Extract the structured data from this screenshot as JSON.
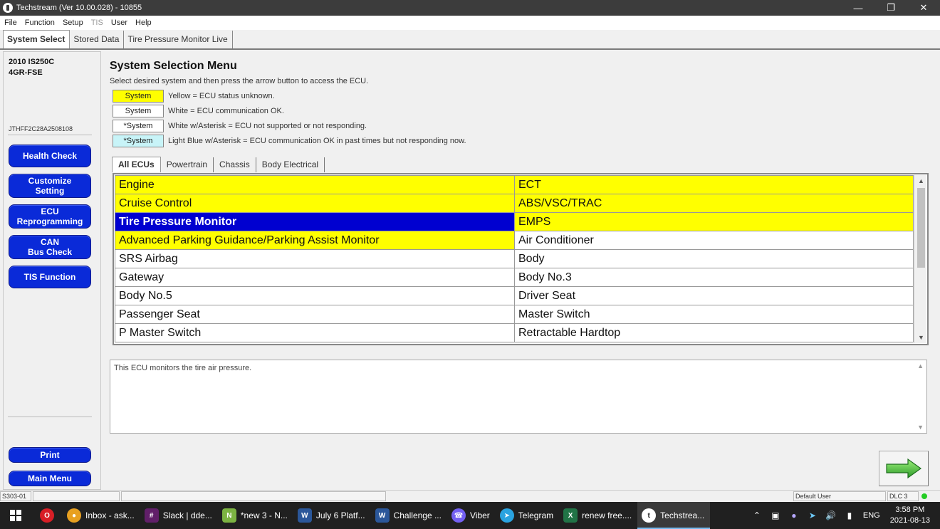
{
  "window": {
    "title": "Techstream (Ver 10.00.028) - 10855"
  },
  "menu": [
    "File",
    "Function",
    "Setup",
    "TIS",
    "User",
    "Help"
  ],
  "top_tabs": [
    "System Select",
    "Stored Data",
    "Tire Pressure Monitor Live"
  ],
  "vehicle": {
    "model": "2010 IS250C",
    "engine": "4GR-FSE",
    "vin": "JTHFF2C28A2508108"
  },
  "left_buttons": [
    "Health Check",
    "Customize\nSetting",
    "ECU\nReprogramming",
    "CAN\nBus Check",
    "TIS Function"
  ],
  "bottom_buttons": {
    "print": "Print",
    "main_menu": "Main Menu"
  },
  "main": {
    "title": "System Selection Menu",
    "instruction": "Select desired system and then press the arrow button to access the ECU."
  },
  "legend": [
    {
      "swatch": "System",
      "text": "Yellow = ECU status unknown.",
      "color": "#ffff00"
    },
    {
      "swatch": "System",
      "text": "White = ECU communication OK.",
      "color": "#ffffff"
    },
    {
      "swatch": "*System",
      "text": "White w/Asterisk = ECU not supported or not responding.",
      "color": "#ffffff"
    },
    {
      "swatch": "*System",
      "text": "Light Blue w/Asterisk = ECU communication OK in past times but not responding now.",
      "color": "#c8f4f8"
    }
  ],
  "ecu_tabs": [
    "All ECUs",
    "Powertrain",
    "Chassis",
    "Body Electrical"
  ],
  "ecu_rows": [
    {
      "left": "Engine",
      "right": "ECT",
      "left_status": "yellow",
      "right_status": "yellow"
    },
    {
      "left": "Cruise Control",
      "right": "ABS/VSC/TRAC",
      "left_status": "yellow",
      "right_status": "yellow"
    },
    {
      "left": "Tire Pressure Monitor",
      "right": "EMPS",
      "left_status": "selected",
      "right_status": "yellow"
    },
    {
      "left": "Advanced Parking Guidance/Parking Assist Monitor",
      "right": "Air Conditioner",
      "left_status": "yellow",
      "right_status": "white"
    },
    {
      "left": "SRS Airbag",
      "right": "Body",
      "left_status": "white",
      "right_status": "white"
    },
    {
      "left": "Gateway",
      "right": "Body No.3",
      "left_status": "white",
      "right_status": "white"
    },
    {
      "left": "Body No.5",
      "right": "Driver Seat",
      "left_status": "white",
      "right_status": "white"
    },
    {
      "left": "Passenger Seat",
      "right": "Master Switch",
      "left_status": "white",
      "right_status": "white"
    },
    {
      "left": "P Master Switch",
      "right": "Retractable Hardtop",
      "left_status": "white",
      "right_status": "white"
    }
  ],
  "description": "This ECU monitors the tire air pressure.",
  "status_bar": {
    "code": "S303-01",
    "user": "Default User",
    "dlc": "DLC 3"
  },
  "taskbar": {
    "items": [
      {
        "label": "Inbox - ask...",
        "icon": "chrome-icon",
        "color": "#e8a020"
      },
      {
        "label": "Slack | dde...",
        "icon": "slack-icon",
        "color": "#611f69"
      },
      {
        "label": "*new 3 - N...",
        "icon": "notepad-plus-icon",
        "color": "#7cb342"
      },
      {
        "label": "July 6 Platf...",
        "icon": "word-icon",
        "color": "#2b579a"
      },
      {
        "label": "Challenge ...",
        "icon": "word-icon",
        "color": "#2b579a"
      },
      {
        "label": "Viber",
        "icon": "viber-icon",
        "color": "#7360f2"
      },
      {
        "label": "Telegram",
        "icon": "telegram-icon",
        "color": "#2aa3e0"
      },
      {
        "label": "renew free....",
        "icon": "excel-icon",
        "color": "#217346"
      },
      {
        "label": "Techstrea...",
        "icon": "techstream-icon",
        "color": "#ffffff"
      }
    ],
    "language": "ENG",
    "time": "3:58 PM",
    "date": "2021-08-13"
  }
}
